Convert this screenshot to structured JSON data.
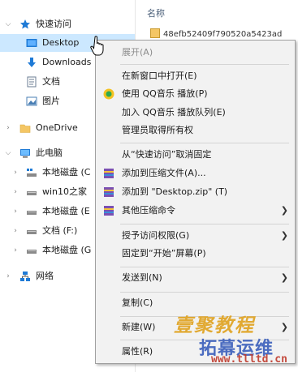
{
  "nav": {
    "quick_access": "快速访问",
    "desktop": "Desktop",
    "downloads": "Downloads",
    "documents": "文档",
    "pictures": "图片",
    "onedrive": "OneDrive",
    "this_pc": "此电脑",
    "drive_c": "本地磁盘 (C",
    "win10_home": "win10之家",
    "drive_e": "本地磁盘 (E",
    "docs_f": "文档 (F:)",
    "drive_g": "本地磁盘 (G",
    "network": "网络"
  },
  "content": {
    "column_name": "名称",
    "file_partial": "48efb52409f790520a5423ad"
  },
  "menu": {
    "expand": "展开(A)",
    "open_new_window": "在新窗口中打开(E)",
    "qq_play": "使用 QQ音乐 播放(P)",
    "qq_queue": "加入 QQ音乐 播放队列(E)",
    "admin_ownership": "管理员取得所有权",
    "unpin_quick": "从“快速访问”取消固定",
    "add_archive": "添加到压缩文件(A)...",
    "add_zip": "添加到 \"Desktop.zip\" (T)",
    "other_compress": "其他压缩命令",
    "grant_access": "授予访问权限(G)",
    "pin_start": "固定到“开始”屏幕(P)",
    "send_to": "发送到(N)",
    "copy": "复制(C)",
    "new": "新建(W)",
    "properties": "属性(R)"
  },
  "watermark": {
    "line1": "壹聚教程",
    "line2": "拓幕运维",
    "line3": "www.tlltd.cn"
  },
  "colors": {
    "selection": "#cce8ff",
    "menu_bg": "#f2f2f2",
    "folder_blue": "#1e7ad6",
    "folder_yellow": "#f4c664"
  }
}
